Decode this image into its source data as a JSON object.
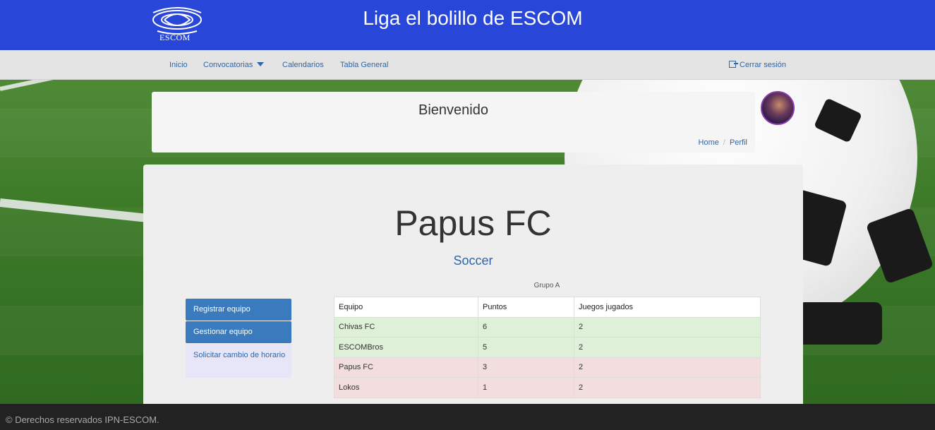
{
  "header": {
    "logo_text": "ESCOM",
    "title": "Liga el bolillo de ESCOM"
  },
  "nav": {
    "items": [
      {
        "label": "Inicio"
      },
      {
        "label": "Convocatorias"
      },
      {
        "label": "Calendarios"
      },
      {
        "label": "Tabla General"
      }
    ],
    "logout_label": "Cerrar sesión",
    "icons": {
      "dropdown": "caret-down-icon",
      "logout": "sign-out-icon"
    }
  },
  "welcome": {
    "title": "Bienvenido",
    "breadcrumb": [
      "Home",
      "Perfil"
    ]
  },
  "team": {
    "name": "Papus FC",
    "sport": "Soccer"
  },
  "sidebar": {
    "buttons": [
      {
        "label": "Registrar equipo"
      },
      {
        "label": "Gestionar equipo"
      },
      {
        "label": "Solicitar cambio de horario"
      }
    ]
  },
  "standings": {
    "group_label": "Grupo A",
    "columns": [
      "Equipo",
      "Puntos",
      "Juegos jugados"
    ],
    "rows": [
      {
        "team": "Chivas FC",
        "points": "6",
        "played": "2"
      },
      {
        "team": "ESCOMBros",
        "points": "5",
        "played": "2"
      },
      {
        "team": "Papus FC",
        "points": "3",
        "played": "2"
      },
      {
        "team": "Lokos",
        "points": "1",
        "played": "2"
      }
    ],
    "colors": {
      "positive": "#dff0d8",
      "negative": "#f2dede"
    }
  },
  "footer": {
    "text": "© Derechos reservados IPN-ESCOM."
  },
  "colors": {
    "header_bg": "#2847d8",
    "link": "#2f66a6",
    "primary_button": "#3a7bbd",
    "footer_bg": "#222222"
  }
}
